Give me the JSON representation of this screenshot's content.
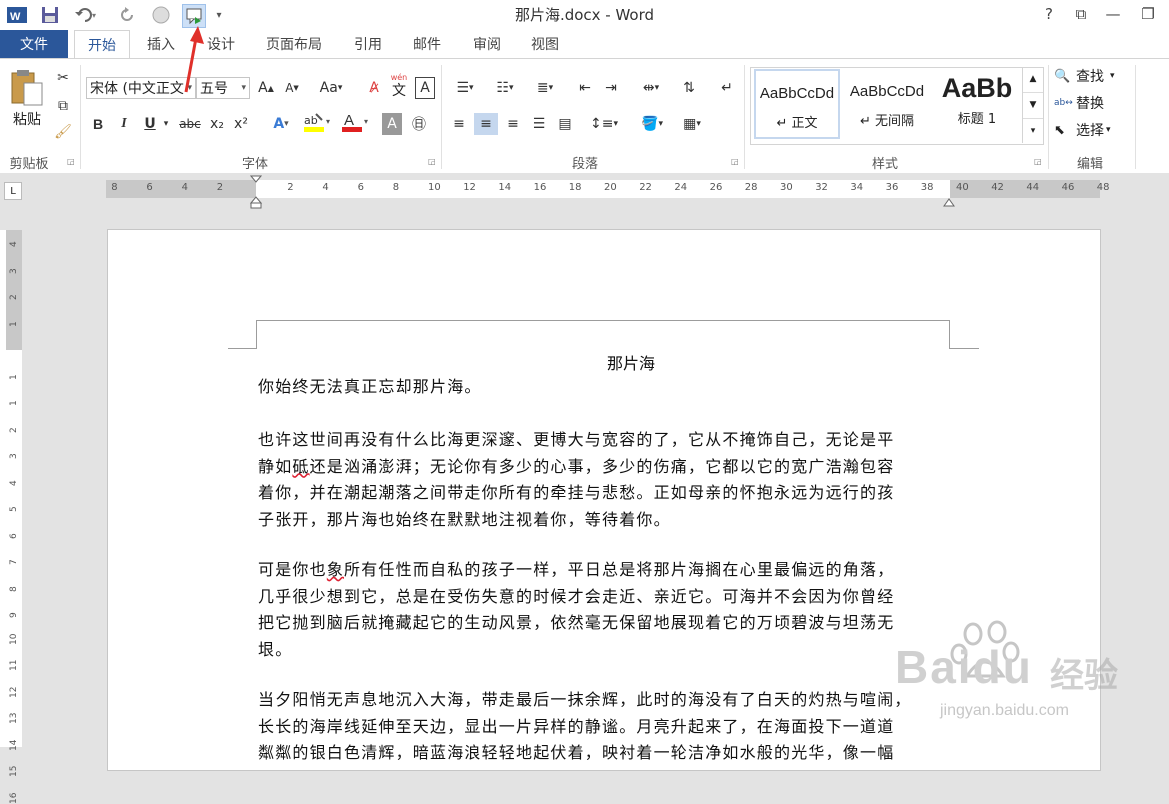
{
  "app": {
    "title": "那片海.docx - Word",
    "window_buttons": {
      "help": "?",
      "ribbon_display": "⧉",
      "minimize": "—",
      "restore": "❐",
      "close": "✕"
    }
  },
  "quick_access": {
    "customize_glyph": "▾"
  },
  "tabs": {
    "file": "文件",
    "items": [
      "开始",
      "插入",
      "设计",
      "页面布局",
      "引用",
      "邮件",
      "审阅",
      "视图"
    ]
  },
  "ribbon": {
    "clipboard": {
      "paste_label": "粘贴",
      "group_label": "剪贴板"
    },
    "font": {
      "font_name": "宋体 (中文正文",
      "font_size": "五号",
      "case_label": "Aa",
      "bold": "B",
      "italic": "I",
      "underline": "U",
      "strike": "abc",
      "subscript": "x₂",
      "superscript": "x²",
      "pinyin_top": "wén",
      "pinyin_char": "文",
      "border_char": "A",
      "group_label": "字体"
    },
    "paragraph": {
      "group_label": "段落"
    },
    "styles": {
      "items": [
        {
          "preview": "AaBbCcDd",
          "name": "↵ 正文"
        },
        {
          "preview": "AaBbCcDd",
          "name": "↵ 无间隔"
        },
        {
          "preview": "AaBb",
          "name": "标题 1"
        }
      ],
      "group_label": "样式"
    },
    "editing": {
      "find": "查找",
      "replace": "替换",
      "select": "选择",
      "group_label": "编辑"
    }
  },
  "ruler": {
    "corner": "L",
    "h_ticks": [
      "8",
      "6",
      "4",
      "2",
      "2",
      "4",
      "6",
      "8",
      "10",
      "12",
      "14",
      "16",
      "18",
      "20",
      "22",
      "24",
      "26",
      "28",
      "30",
      "32",
      "34",
      "36",
      "38",
      "40",
      "42",
      "44",
      "46",
      "48"
    ],
    "v_ticks": [
      "4",
      "3",
      "2",
      "1",
      "1",
      "1",
      "2",
      "3",
      "4",
      "5",
      "6",
      "7",
      "8",
      "9",
      "10",
      "11",
      "12",
      "13",
      "14",
      "15",
      "16"
    ]
  },
  "document": {
    "heading": "那片海",
    "paragraphs": [
      [
        "你始终无法真正忘却那片海。"
      ],
      [
        "也许这世间再没有什么比海更深邃、更博大与宽容的了，它从不掩饰自己，无论是平",
        "静如砥还是汹涌澎湃；无论你有多少的心事，多少的伤痛，它都以它的宽广浩瀚包容",
        "着你，并在潮起潮落之间带走你所有的牵挂与悲愁。正如母亲的怀抱永远为远行的孩",
        "子张开，那片海也始终在默默地注视着你，等待着你。"
      ],
      [
        "可是你也象所有任性而自私的孩子一样，平日总是将那片海搁在心里最偏远的角落，",
        "几乎很少想到它，总是在受伤失意的时候才会走近、亲近它。可海并不会因为你曾经",
        "把它抛到脑后就掩藏起它的生动风景，依然毫无保留地展现着它的万顷碧波与坦荡无",
        "垠。"
      ],
      [
        "当夕阳悄无声息地沉入大海，带走最后一抹余辉，此时的海没有了白天的灼热与喧闹，",
        "长长的海岸线延伸至天边，显出一片异样的静谧。月亮升起来了，在海面投下一道道",
        "粼粼的银白色清辉，暗蓝海浪轻轻地起伏着，映衬着一轮洁净如水般的光华，像一幅"
      ]
    ]
  },
  "watermark": {
    "brand": "Bai",
    "brand2": "du",
    "suffix": "经验",
    "url": "jingyan.baidu.com"
  },
  "colors": {
    "accent": "#2b579a",
    "annotation_red": "#e0302a"
  }
}
